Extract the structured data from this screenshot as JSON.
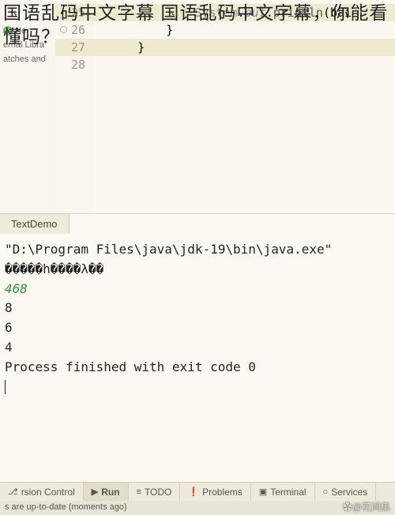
{
  "overlay": "国语乱码中文字幕 国语乱码中文字幕，你能看懂吗？",
  "sidebar": {
    "items": [
      "He",
      "ernal Libra",
      "atches and"
    ]
  },
  "editor": {
    "lines": [
      {
        "num": "25",
        "code": "            System.out.println(bai",
        "highlight": true
      },
      {
        "num": "26",
        "code": "        }",
        "dot": true
      },
      {
        "num": "27",
        "code": "    }",
        "highlight": true
      },
      {
        "num": "28",
        "code": ""
      }
    ]
  },
  "run": {
    "tab": "TextDemo",
    "output": [
      {
        "text": "\"D:\\Program Files\\java\\jdk-19\\bin\\java.exe\"",
        "cls": ""
      },
      {
        "text": "�����h����λ��",
        "cls": ""
      },
      {
        "text": "468",
        "cls": "console-green"
      },
      {
        "text": "8",
        "cls": ""
      },
      {
        "text": "6",
        "cls": ""
      },
      {
        "text": "4",
        "cls": ""
      },
      {
        "text": "",
        "cls": ""
      },
      {
        "text": "Process finished with exit code 0",
        "cls": ""
      }
    ]
  },
  "bottomBar": {
    "items": [
      {
        "icon": "⎇",
        "label": "rsion Control"
      },
      {
        "icon": "▶",
        "label": "Run",
        "active": true
      },
      {
        "icon": "≡",
        "label": "TODO"
      },
      {
        "icon": "❗",
        "label": "Problems"
      },
      {
        "icon": "▣",
        "label": "Terminal"
      },
      {
        "icon": "○",
        "label": "Services"
      }
    ]
  },
  "statusBar": "s are up-to-date (moments ago)",
  "watermark": "✿@花间集"
}
